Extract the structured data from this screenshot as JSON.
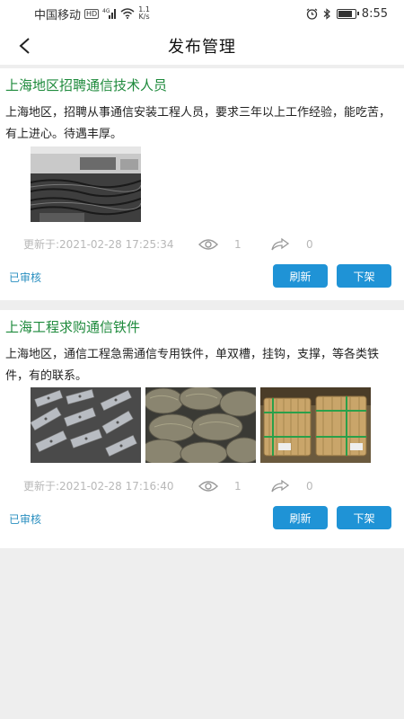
{
  "status_bar": {
    "carrier": "中国移动",
    "hd": "HD",
    "net_type": "4G",
    "speed_value": "1.1",
    "speed_unit": "K/s",
    "time": "8:55",
    "battery_level": 0.85
  },
  "header": {
    "title": "发布管理",
    "back_icon": "chevron-left-icon"
  },
  "posts": [
    {
      "title": "上海地区招聘通信技术人员",
      "description": "上海地区，招聘从事通信安装工程人员，要求三年以上工作经验，能吃苦，有上进心。待遇丰厚。",
      "updated": "更新于:2021-02-28 17:25:34",
      "views": "1",
      "shares": "0",
      "status": "已审核",
      "refresh_label": "刷新",
      "offshelf_label": "下架"
    },
    {
      "title": "上海工程求购通信铁件",
      "description": "上海地区，通信工程急需通信专用铁件，单双槽，挂钩，支撑，等各类铁件，有的联系。",
      "updated": "更新于:2021-02-28 17:16:40",
      "views": "1",
      "shares": "0",
      "status": "已审核",
      "refresh_label": "刷新",
      "offshelf_label": "下架"
    }
  ],
  "colors": {
    "title_green": "#1e8a3c",
    "button_blue": "#1f93d6",
    "status_blue": "#2a8fc0",
    "background": "#eeeeee"
  }
}
